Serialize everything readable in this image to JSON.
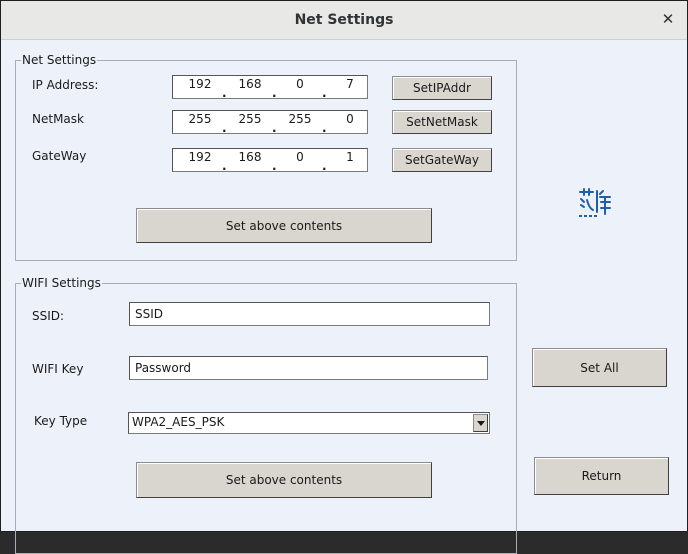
{
  "window": {
    "title": "Net Settings",
    "close_glyph": "✕"
  },
  "net_settings": {
    "legend": "Net Settings",
    "ip_address": {
      "label": "IP Address:",
      "octets": [
        "192",
        "168",
        "0",
        "7"
      ],
      "button": "SetIPAddr"
    },
    "netmask": {
      "label": "NetMask",
      "octets": [
        "255",
        "255",
        "255",
        "0"
      ],
      "button": "SetNetMask"
    },
    "gateway": {
      "label": "GateWay",
      "octets": [
        "192",
        "168",
        "0",
        "1"
      ],
      "button": "SetGateWay"
    },
    "set_button": "Set above contents"
  },
  "wifi_settings": {
    "legend": "WIFI Settings",
    "ssid": {
      "label": "SSID:",
      "value": "SSID"
    },
    "wifi_key": {
      "label": "WIFI Key",
      "value": "Password"
    },
    "key_type": {
      "label": "Key Type",
      "value": "WPA2_AES_PSK"
    },
    "set_button": "Set above contents"
  },
  "actions": {
    "set_all": "Set All",
    "return": "Return"
  },
  "logo": {
    "icon": "company-logo-icon",
    "color": "#1f5fa8"
  }
}
